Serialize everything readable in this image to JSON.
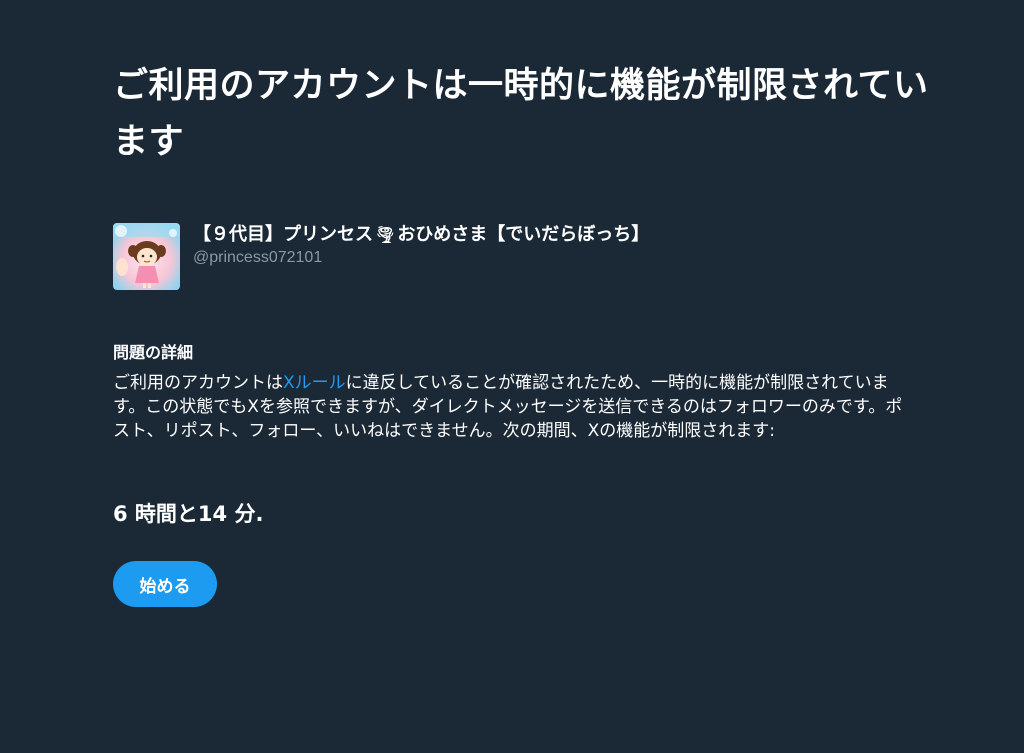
{
  "page": {
    "title": "ご利用のアカウントは一時的に機能が制限されています"
  },
  "profile": {
    "name_prefix": "【９代目】プリンセス",
    "name_suffix": "おひめさま【でいだらぼっち】",
    "handle": "@princess072101",
    "emoji_icon": "tornado-icon"
  },
  "details": {
    "heading": "問題の詳細",
    "text_before_link": "ご利用のアカウントは",
    "link_text": "Xルール",
    "text_after_link": "に違反していることが確認されたため、一時的に機能が制限されています。この状態でもXを参照できますが、ダイレクトメッセージを送信できるのはフォロワーのみです。ポスト、リポスト、フォロー、いいねはできません。次の期間、Xの機能が制限されます:"
  },
  "duration": "6 時間と14 分.",
  "actions": {
    "start_label": "始める"
  },
  "colors": {
    "background": "#1b2836",
    "accent": "#1d9bf0",
    "secondary_text": "#8899a6"
  }
}
